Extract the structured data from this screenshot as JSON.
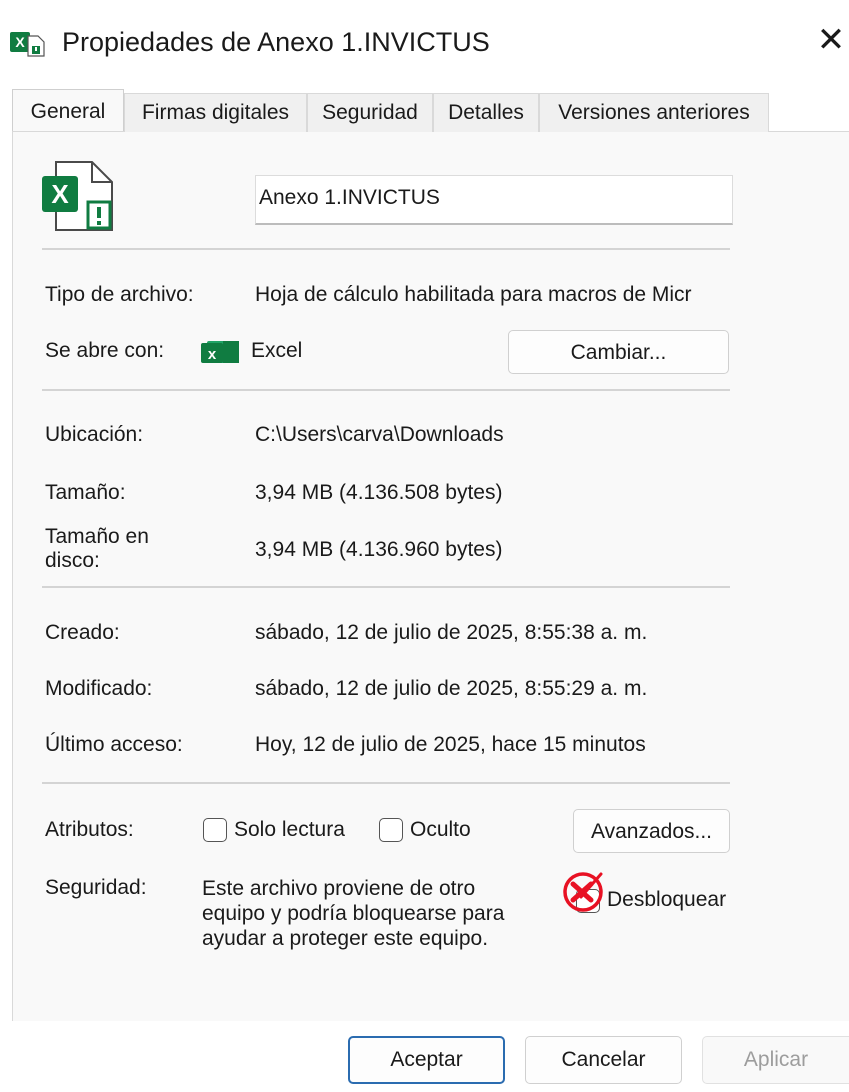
{
  "window": {
    "title": "Propiedades de Anexo 1.INVICTUS",
    "close_glyph": "✕"
  },
  "tabs": [
    {
      "label": "General",
      "active": true
    },
    {
      "label": "Firmas digitales",
      "active": false
    },
    {
      "label": "Seguridad",
      "active": false
    },
    {
      "label": "Detalles",
      "active": false
    },
    {
      "label": "Versiones anteriores",
      "active": false
    }
  ],
  "file": {
    "name": "Anexo 1.INVICTUS",
    "type_label": "Tipo de archivo:",
    "type_value": "Hoja de cálculo habilitada para macros de Micr",
    "opens_with_label": "Se abre con:",
    "opens_with_value": "Excel",
    "change_button": "Cambiar...",
    "location_label": "Ubicación:",
    "location_value": "C:\\Users\\carva\\Downloads",
    "size_label": "Tamaño:",
    "size_value": "3,94 MB (4.136.508 bytes)",
    "disk_size_label_1": "Tamaño en",
    "disk_size_label_2": "disco:",
    "disk_size_value": "3,94 MB (4.136.960 bytes)",
    "created_label": "Creado:",
    "created_value": "sábado, 12 de julio de 2025, 8:55:38 a. m.",
    "modified_label": "Modificado:",
    "modified_value": "sábado, 12 de julio de 2025, 8:55:29 a. m.",
    "accessed_label": "Último acceso:",
    "accessed_value": "Hoy, 12 de julio de 2025, hace 15 minutos"
  },
  "attributes": {
    "label": "Atributos:",
    "readonly_label": "Solo lectura",
    "hidden_label": "Oculto",
    "advanced_button": "Avanzados..."
  },
  "security": {
    "label": "Seguridad:",
    "message_line_1": "Este archivo proviene de otro",
    "message_line_2": "equipo y podría bloquearse para",
    "message_line_3": "ayudar a proteger este equipo.",
    "unblock_label": "Desbloquear"
  },
  "footer": {
    "ok_button": "Aceptar",
    "cancel_button": "Cancelar",
    "apply_button": "Aplicar"
  },
  "colors": {
    "excel_green": "#107c41",
    "annotation_red": "#e81123",
    "primary_border": "#2b6cb0"
  },
  "icons": {
    "app": "excel-file-icon",
    "file": "excel-blocked-file-icon",
    "excel": "excel-app-icon",
    "annotation": "red-circle-x-icon"
  }
}
